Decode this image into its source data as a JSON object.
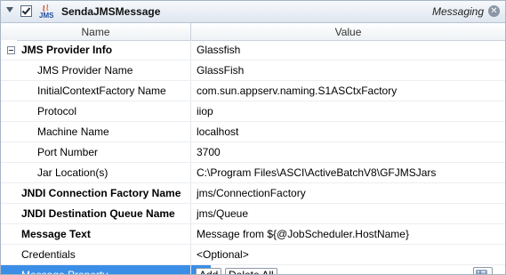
{
  "titlebar": {
    "title": "SendaJMSMessage",
    "category": "Messaging",
    "icon_text": "JMS",
    "close_glyph": "✕"
  },
  "columns": {
    "name": "Name",
    "value": "Value"
  },
  "rows": [
    {
      "name": "JMS Provider Info",
      "value": "Glassfish"
    },
    {
      "name": "JMS Provider Name",
      "value": "GlassFish"
    },
    {
      "name": "InitialContextFactory Name",
      "value": "com.sun.appserv.naming.S1ASCtxFactory"
    },
    {
      "name": "Protocol",
      "value": "iiop"
    },
    {
      "name": "Machine Name",
      "value": "localhost"
    },
    {
      "name": "Port Number",
      "value": "3700"
    },
    {
      "name": "Jar Location(s)",
      "value": "C:\\Program Files\\ASCI\\ActiveBatchV8\\GFJMSJars"
    },
    {
      "name": "JNDI Connection Factory Name",
      "value": "jms/ConnectionFactory"
    },
    {
      "name": "JNDI Destination Queue Name",
      "value": "jms/Queue"
    },
    {
      "name": "Message Text",
      "value": "Message from ${@JobScheduler.HostName}"
    },
    {
      "name": "Credentials",
      "value": "<Optional>"
    },
    {
      "name": "Message Property",
      "value": ""
    }
  ],
  "buttons": {
    "add": "Add",
    "delete_all": "Delete All"
  },
  "colors": {
    "selection": "#3a8ee6",
    "titlebar": "#dfe6ef"
  }
}
